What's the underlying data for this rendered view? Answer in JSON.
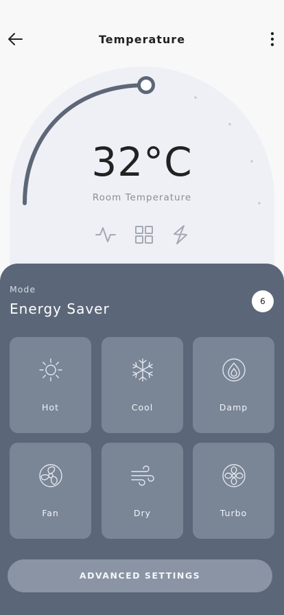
{
  "header": {
    "title": "Temperature",
    "back_icon": "arrow-left-icon",
    "more_icon": "more-vertical-icon"
  },
  "thermostat": {
    "temperature": "32°C",
    "label": "Room Temperature",
    "level": 0.3,
    "icons": [
      "activity-icon",
      "grid-icon",
      "bolt-icon"
    ]
  },
  "mode": {
    "label": "Mode",
    "value": "Energy Saver",
    "badge": "6",
    "tiles": [
      {
        "label": "Hot",
        "icon": "sun-icon"
      },
      {
        "label": "Cool",
        "icon": "snowflake-icon"
      },
      {
        "label": "Damp",
        "icon": "drop-fire-icon"
      },
      {
        "label": "Fan",
        "icon": "fan-icon"
      },
      {
        "label": "Dry",
        "icon": "wind-icon"
      },
      {
        "label": "Turbo",
        "icon": "turbo-fan-icon"
      }
    ],
    "advanced_label": "ADVANCED SETTINGS"
  },
  "colors": {
    "background": "#f8f8f8",
    "dial": "#eef0f6",
    "arc": "#5d6778",
    "panel": "#5b6779",
    "tile": "#7a8596",
    "button": "#8a94a4"
  }
}
